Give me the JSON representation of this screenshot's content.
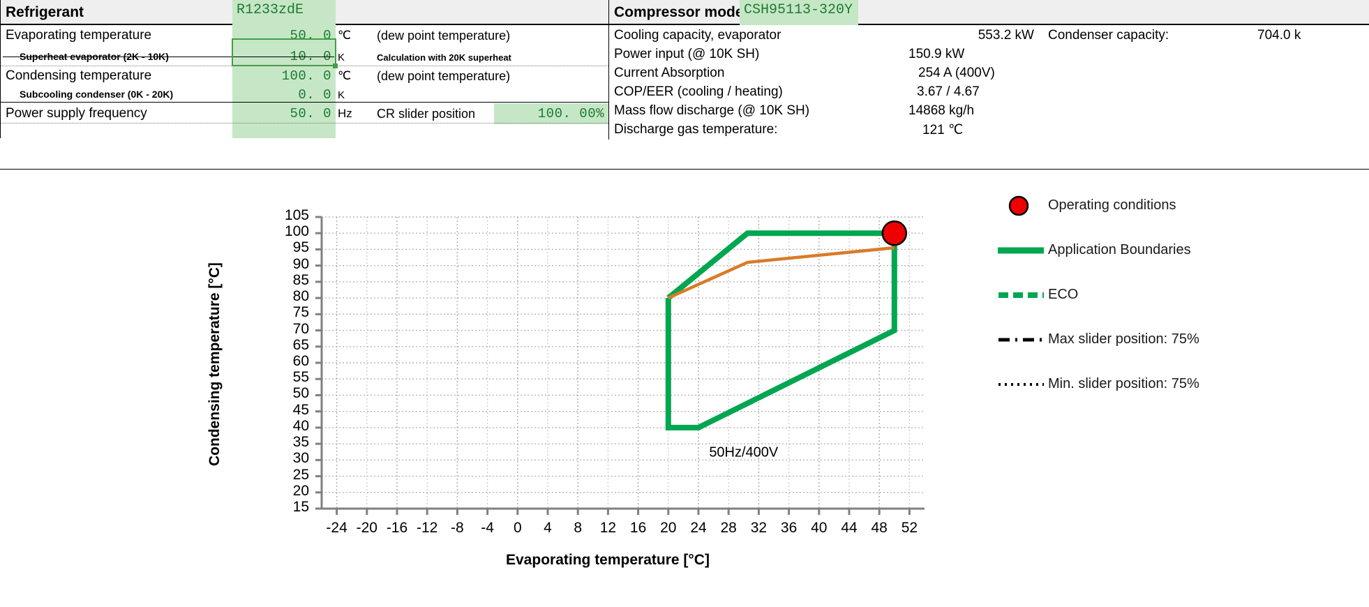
{
  "left_panel": {
    "header": {
      "title": "Refrigerant",
      "value": "R1233zdE"
    },
    "rows": [
      {
        "label": "Evaporating temperature",
        "value": "50. 0",
        "unit": "℃",
        "note": "(dew point temperature)"
      },
      {
        "label": "Superheat evaporator (2K - 10K)",
        "value": "10. 0",
        "unit": "K",
        "note": "Calculation with 20K superheat"
      },
      {
        "label": "Condensing temperature",
        "value": "100. 0",
        "unit": "℃",
        "note": "(dew point temperature)"
      },
      {
        "label": "Subcooling condenser (0K - 20K)",
        "value": "0. 0",
        "unit": "K",
        "note": ""
      },
      {
        "label": "Power supply frequency",
        "value": "50. 0",
        "unit": "Hz",
        "note": "CR slider position",
        "note2": "100. 00%"
      }
    ]
  },
  "right_panel": {
    "header": {
      "title": "Compressor model",
      "value": "CSH95113-320Y"
    },
    "rows": [
      {
        "label": "Cooling capacity, evaporator",
        "value": "553.2 kW",
        "extra_label": "Condenser capacity:",
        "extra_value": "704.0 k"
      },
      {
        "label": "Power input (@ 10K SH)",
        "value": "150.9 kW"
      },
      {
        "label": "Current Absorption",
        "value": "254 A (400V)"
      },
      {
        "label": "COP/EER (cooling / heating)",
        "value": "3.67 /  4.67"
      },
      {
        "label": "Mass flow discharge (@ 10K SH)",
        "value": "14868 kg/h"
      },
      {
        "label": "Discharge gas temperature:",
        "value": "121 ℃"
      }
    ]
  },
  "legend": {
    "items": [
      {
        "mark": "red-dot-marker",
        "label": "Operating conditions"
      },
      {
        "mark": "green-solid-line",
        "label": "Application Boundaries"
      },
      {
        "mark": "green-dashed-line",
        "label": "ECO"
      },
      {
        "mark": "black-dashdot-line",
        "label": "Max slider position: 75%"
      },
      {
        "mark": "black-dotted-line",
        "label": "Min. slider position: 75%"
      }
    ]
  },
  "colors": {
    "envelope_green": "#00a650",
    "eco_orange": "#d97b28",
    "operating_red": "#ee0000",
    "cell_green_bg": "#c6e7c6",
    "cell_green_text": "#1b7a33",
    "grid_gray": "#b5b5b5"
  },
  "chart_data": {
    "type": "line",
    "title": "",
    "xlabel": "Evaporating temperature [°C]",
    "ylabel": "Condensing temperature [°C]",
    "xlim": [
      -26,
      54
    ],
    "ylim": [
      15,
      105
    ],
    "xticks": [
      -24,
      -20,
      -16,
      -12,
      -8,
      -4,
      0,
      4,
      8,
      12,
      16,
      20,
      24,
      28,
      32,
      36,
      40,
      44,
      48,
      52
    ],
    "yticks": [
      15,
      20,
      25,
      30,
      35,
      40,
      45,
      50,
      55,
      60,
      65,
      70,
      75,
      80,
      85,
      90,
      95,
      100,
      105
    ],
    "grid": true,
    "legend_position": "right",
    "annotations": [
      {
        "text": "50Hz/400V",
        "x": 30,
        "y": 31
      }
    ],
    "series": [
      {
        "name": "Application Boundaries",
        "color": "#00a650",
        "style": "solid",
        "points": [
          [
            20,
            80
          ],
          [
            30.5,
            100
          ],
          [
            50,
            100
          ],
          [
            50,
            70
          ],
          [
            24,
            40
          ],
          [
            20,
            40
          ],
          [
            20,
            80
          ]
        ]
      },
      {
        "name": "ECO",
        "color": "#d97b28",
        "style": "solid",
        "points": [
          [
            20,
            80
          ],
          [
            30.5,
            91
          ],
          [
            50,
            95.5
          ]
        ]
      }
    ],
    "markers": [
      {
        "name": "Operating conditions",
        "x": 50,
        "y": 100,
        "color": "#ee0000",
        "edge": "#000000",
        "size": 34
      }
    ]
  }
}
